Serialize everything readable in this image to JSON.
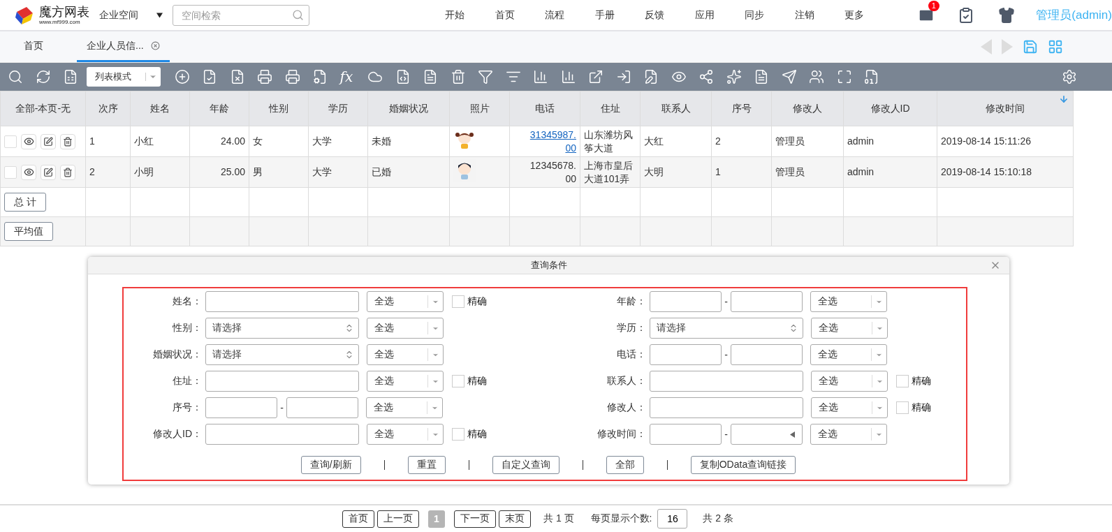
{
  "header": {
    "logo_title": "魔方网表",
    "logo_url": "www.mf999.com",
    "space": "企业空间",
    "search_placeholder": "空间检索",
    "nav": [
      "开始",
      "首页",
      "流程",
      "手册",
      "反馈",
      "应用",
      "同步",
      "注销",
      "更多"
    ],
    "mail_badge": "1",
    "user": "管理员(admin)"
  },
  "tabs": [
    {
      "label": "首页",
      "selected": false,
      "closable": false
    },
    {
      "label": "企业人员信...",
      "selected": true,
      "closable": true
    }
  ],
  "toolbar": {
    "view_mode": "列表模式",
    "formula": "fx"
  },
  "table": {
    "select_header": "全部-本页-无",
    "columns": [
      {
        "label": "次序",
        "sorted": false
      },
      {
        "label": "姓名",
        "sorted": false
      },
      {
        "label": "年龄",
        "sorted": false
      },
      {
        "label": "性别",
        "sorted": false
      },
      {
        "label": "学历",
        "sorted": false
      },
      {
        "label": "婚姻状况",
        "sorted": false
      },
      {
        "label": "照片",
        "sorted": false
      },
      {
        "label": "电话",
        "sorted": false
      },
      {
        "label": "住址",
        "sorted": false
      },
      {
        "label": "联系人",
        "sorted": false
      },
      {
        "label": "序号",
        "sorted": false
      },
      {
        "label": "修改人",
        "sorted": false
      },
      {
        "label": "修改人ID",
        "sorted": false
      },
      {
        "label": "修改时间",
        "sorted": true
      }
    ],
    "rows": [
      {
        "checked": false,
        "order": "1",
        "name": "小红",
        "age": "24.00",
        "gender": "女",
        "education": "大学",
        "marital": "未婚",
        "phone": "31345987.00",
        "phone_link": true,
        "address": "山东潍坊风筝大道",
        "contact": "大红",
        "seq": "2",
        "modifier": "管理员",
        "modifier_id": "admin",
        "modified": "2019-08-14 15:11:26"
      },
      {
        "checked": false,
        "order": "2",
        "name": "小明",
        "age": "25.00",
        "gender": "男",
        "education": "大学",
        "marital": "已婚",
        "phone": "12345678.00",
        "phone_link": false,
        "address": "上海市皇后大道101弄",
        "contact": "大明",
        "seq": "1",
        "modifier": "管理员",
        "modifier_id": "admin",
        "modified": "2019-08-14 15:10:18"
      }
    ],
    "summary_rows": [
      "总 计",
      "平均值"
    ]
  },
  "query": {
    "title": "查询条件",
    "fields": [
      {
        "label": "姓名：",
        "kind": "text",
        "match": "全选",
        "exact": {
          "label": "精确",
          "checked": false
        }
      },
      {
        "label": "年龄：",
        "kind": "range",
        "separator": "-",
        "match": "全选"
      },
      {
        "label": "性别：",
        "kind": "choice",
        "value": "请选择",
        "match": "全选"
      },
      {
        "label": "学历：",
        "kind": "choice",
        "value": "请选择",
        "match": "全选"
      },
      {
        "label": "婚姻状况：",
        "kind": "choice",
        "value": "请选择",
        "match": "全选"
      },
      {
        "label": "电话：",
        "kind": "range",
        "separator": "-",
        "match": "全选"
      },
      {
        "label": "住址：",
        "kind": "text",
        "match": "全选",
        "exact": {
          "label": "精确",
          "checked": false
        }
      },
      {
        "label": "联系人：",
        "kind": "text",
        "match": "全选",
        "exact": {
          "label": "精确",
          "checked": false
        }
      },
      {
        "label": "序号：",
        "kind": "range",
        "separator": "-",
        "match": "全选"
      },
      {
        "label": "修改人：",
        "kind": "text",
        "match": "全选",
        "exact": {
          "label": "精确",
          "checked": false
        }
      },
      {
        "label": "修改人ID：",
        "kind": "text",
        "match": "全选",
        "exact": {
          "label": "精确",
          "checked": false
        }
      },
      {
        "label": "修改时间：",
        "kind": "date_range",
        "separator": "-",
        "match": "全选"
      }
    ],
    "buttons": [
      "查询/刷新",
      "重置",
      "自定义查询",
      "全部",
      "复制OData查询链接"
    ]
  },
  "pager": {
    "nav_before": [
      "首页",
      "上一页"
    ],
    "pages": [
      {
        "label": "1",
        "selected": true
      }
    ],
    "nav_after": [
      "下一页",
      "末页"
    ],
    "total_pages": "共 1 页",
    "page_size_label": "每页显示个数:",
    "page_size": "16",
    "total_items": "共 2 条"
  }
}
